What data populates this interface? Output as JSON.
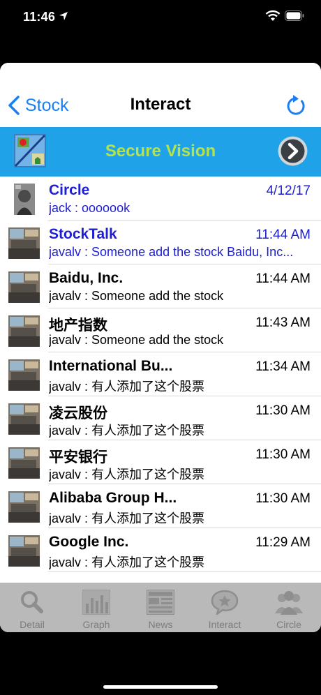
{
  "status_bar": {
    "time": "11:46"
  },
  "nav": {
    "back_label": "Stock",
    "title": "Interact"
  },
  "banner": {
    "text": "Secure Vision",
    "text_color": "#b6e24a",
    "background": "#1fa2e8"
  },
  "accent_color": "#1a7ff5",
  "messages": [
    {
      "title": "Circle",
      "time": "4/12/17",
      "subtitle": "jack : ooooook",
      "highlighted": true
    },
    {
      "title": "StockTalk",
      "time": "11:44 AM",
      "subtitle": "javalv : Someone add the stock Baidu, Inc...",
      "highlighted": true
    },
    {
      "title": "Baidu, Inc.",
      "time": "11:44 AM",
      "subtitle": "javalv : Someone add the stock",
      "highlighted": false
    },
    {
      "title": "地产指数",
      "time": "11:43 AM",
      "subtitle": "javalv : Someone add the stock",
      "highlighted": false
    },
    {
      "title": "International Bu...",
      "time": "11:34 AM",
      "subtitle": "javalv : 有人添加了这个股票",
      "highlighted": false
    },
    {
      "title": "凌云股份",
      "time": "11:30 AM",
      "subtitle": "javalv : 有人添加了这个股票",
      "highlighted": false
    },
    {
      "title": "平安银行",
      "time": "11:30 AM",
      "subtitle": "javalv : 有人添加了这个股票",
      "highlighted": false
    },
    {
      "title": "Alibaba Group H...",
      "time": "11:30 AM",
      "subtitle": "javalv : 有人添加了这个股票",
      "highlighted": false
    },
    {
      "title": "Google Inc.",
      "time": "11:29 AM",
      "subtitle": "javalv : 有人添加了这个股票",
      "highlighted": false
    }
  ],
  "tabs": [
    {
      "label": "Detail",
      "icon": "magnifier-icon"
    },
    {
      "label": "Graph",
      "icon": "bar-graph-icon"
    },
    {
      "label": "News",
      "icon": "newspaper-icon"
    },
    {
      "label": "Interact",
      "icon": "chat-star-icon"
    },
    {
      "label": "Circle",
      "icon": "people-icon"
    }
  ]
}
